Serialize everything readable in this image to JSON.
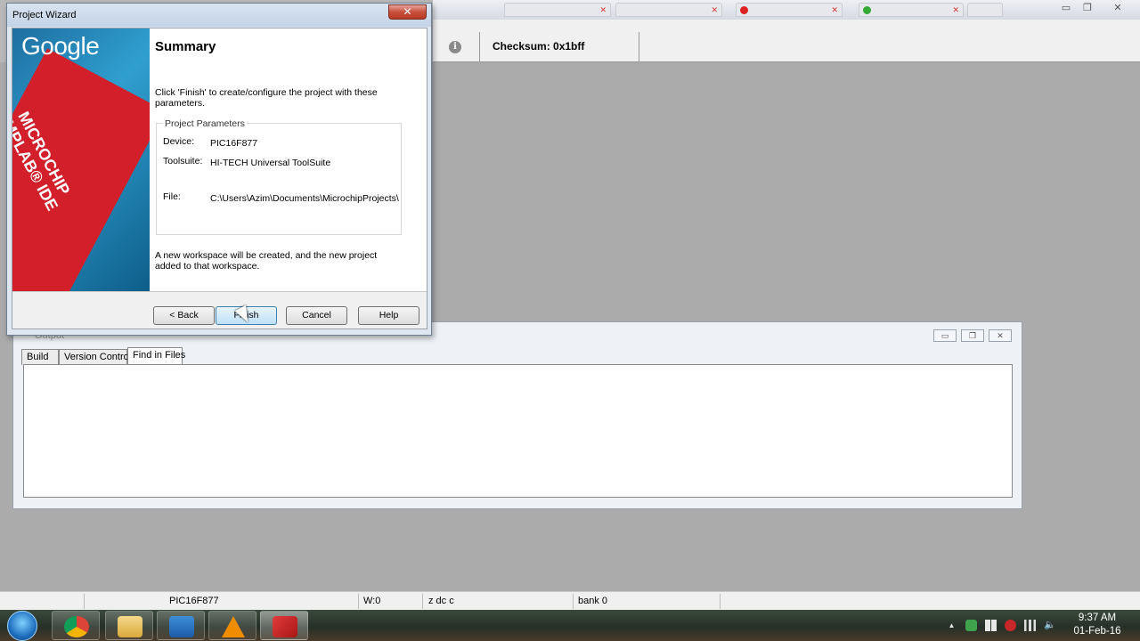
{
  "wizard": {
    "title": "Project Wizard",
    "close_glyph": "✕",
    "banner_google": "Google",
    "banner_lines": [
      "MICROCHIP",
      "MPLAB® IDE"
    ],
    "heading": "Summary",
    "intro": "Click 'Finish' to create/configure the project with these parameters.",
    "params_legend": "Project Parameters",
    "params": {
      "device_label": "Device:",
      "device_value": "PIC16F877",
      "toolsuite_label": "Toolsuite:",
      "toolsuite_value": "HI-TECH Universal ToolSuite",
      "file_label": "File:",
      "file_value": "C:\\Users\\Azim\\Documents\\MicrochipProjects\\"
    },
    "outro": "A new workspace will be created, and the new project added to that workspace.",
    "buttons": {
      "back": "< Back",
      "finish": "Finish",
      "cancel": "Cancel",
      "help": "Help"
    }
  },
  "toolbar": {
    "checksum": "Checksum:  0x1bff",
    "info_glyph": "i"
  },
  "window_controls": {
    "minimize": "▭",
    "restore": "❐",
    "close": "✕"
  },
  "output": {
    "title": "Output",
    "tabs": [
      "Build",
      "Version Control",
      "Find in Files"
    ],
    "active_tab": "Find in Files",
    "controls": {
      "minimize": "▭",
      "restore": "❐",
      "close": "✕"
    }
  },
  "statusbar": {
    "device": "PIC16F877",
    "w": "W:0",
    "flags": "z dc c",
    "bank": "bank 0"
  },
  "taskbar": {
    "apps": [
      "chrome-icon",
      "file-explorer-icon",
      "outlook-icon",
      "vlc-icon",
      "mplab-icon"
    ],
    "tray_glyphs": {
      "show_hidden": "▲",
      "volume": "🔈"
    }
  },
  "clock": {
    "time": "9:37 AM",
    "date": "01-Feb-16"
  },
  "colors": {
    "dialog_bg": "#dfe7f1",
    "accent_blue": "#3c7fb1",
    "banner_red": "#d21f2a"
  }
}
